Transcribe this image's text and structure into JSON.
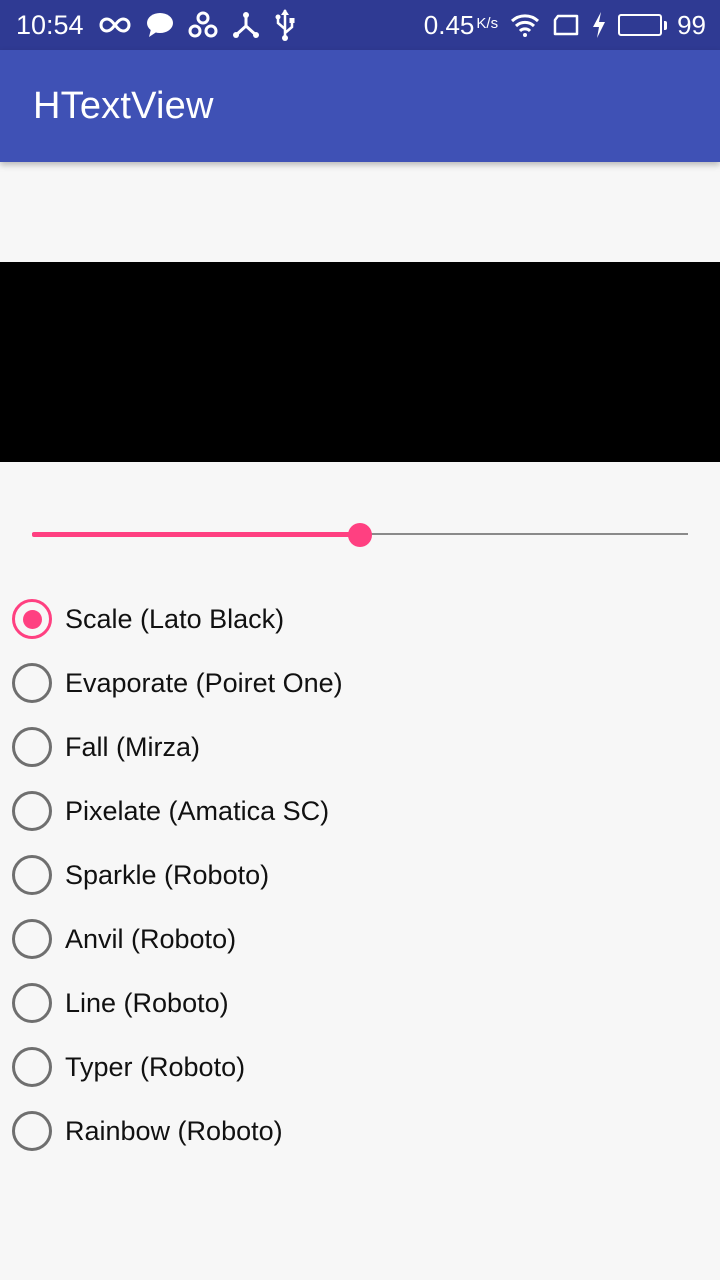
{
  "status_bar": {
    "time": "10:54",
    "left_icons": [
      "infinity-icon",
      "chat-bubble-icon",
      "share-icon",
      "usb-tree-icon",
      "usb-icon"
    ],
    "net_speed": "0.45",
    "net_unit": "K/s",
    "right_icons": [
      "wifi-icon",
      "sim-icon",
      "charging-icon"
    ],
    "battery_level": "99",
    "battery_color": "#35d23a"
  },
  "app_bar": {
    "title": "HTextView",
    "color": "#3f51b5"
  },
  "text_area": {
    "background": "#000000"
  },
  "seekbar": {
    "progress_fraction": 0.5,
    "accent": "#ff4081"
  },
  "effects": {
    "selected_index": 0,
    "options": [
      {
        "label": "Scale (Lato Black)"
      },
      {
        "label": "Evaporate (Poiret One)"
      },
      {
        "label": "Fall (Mirza)"
      },
      {
        "label": "Pixelate (Amatica SC)"
      },
      {
        "label": "Sparkle (Roboto)"
      },
      {
        "label": "Anvil (Roboto)"
      },
      {
        "label": "Line (Roboto)"
      },
      {
        "label": "Typer (Roboto)"
      },
      {
        "label": "Rainbow (Roboto)"
      }
    ]
  }
}
